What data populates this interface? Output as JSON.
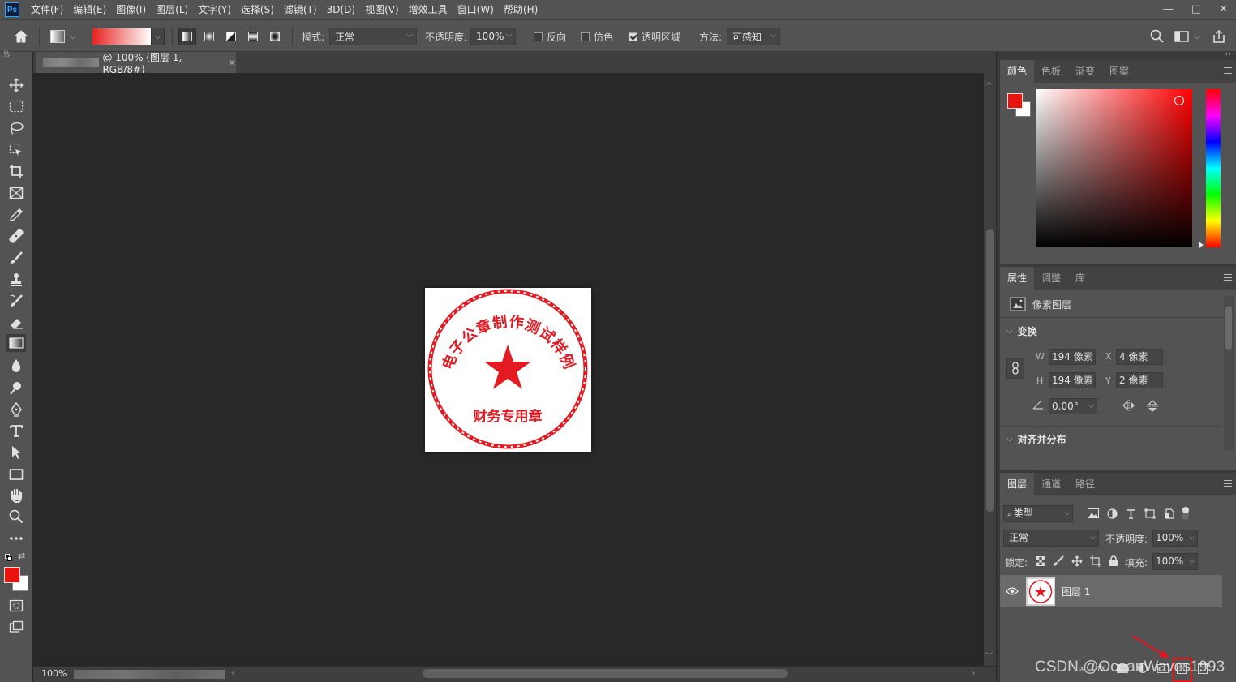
{
  "app": {
    "logo": "Ps"
  },
  "menubar": {
    "items": [
      "文件(F)",
      "编辑(E)",
      "图像(I)",
      "图层(L)",
      "文字(Y)",
      "选择(S)",
      "滤镜(T)",
      "3D(D)",
      "视图(V)",
      "增效工具",
      "窗口(W)",
      "帮助(H)"
    ],
    "window_buttons": [
      "—",
      "□",
      "✕"
    ]
  },
  "options": {
    "mode_label": "模式:",
    "mode_value": "正常",
    "opacity_label": "不透明度:",
    "opacity_value": "100%",
    "reverse_label": "反向",
    "reverse_checked": false,
    "dither_label": "仿色",
    "dither_checked": false,
    "transparency_label": "透明区域",
    "transparency_checked": true,
    "method_label": "方法:",
    "method_value": "可感知",
    "gradient_colors": [
      "#e8231f",
      "#ffffff"
    ]
  },
  "document": {
    "tab_title": "@ 100% (图层 1, RGB/8#)",
    "close": "×",
    "zoom": "100%"
  },
  "stamp": {
    "arc_text": "电子公章制作测试样例",
    "bottom_text": "财务专用章",
    "color": "#e21b23"
  },
  "colors": {
    "foreground": "#e8140f",
    "background": "#ffffff",
    "accent": "#31a8ff"
  },
  "color_panel": {
    "tabs": [
      "颜色",
      "色板",
      "渐变",
      "图案"
    ],
    "active_tab": "颜色",
    "foreground": "#e8140f",
    "background": "#ffffff"
  },
  "properties_panel": {
    "tabs": [
      "属性",
      "调整",
      "库"
    ],
    "active_tab": "属性",
    "layer_type": "像素图层",
    "transform_header": "变换",
    "w_label": "W",
    "w_value": "194 像素",
    "x_label": "X",
    "x_value": "4 像素",
    "h_label": "H",
    "h_value": "194 像素",
    "y_label": "Y",
    "y_value": "2 像素",
    "angle_value": "0.00°",
    "align_header": "对齐并分布"
  },
  "layers_panel": {
    "tabs": [
      "图层",
      "通道",
      "路径"
    ],
    "active_tab": "图层",
    "filter_label": "类型",
    "blend_mode": "正常",
    "opacity_label": "不透明度:",
    "opacity_value": "100%",
    "lock_label": "锁定:",
    "fill_label": "填充:",
    "fill_value": "100%",
    "layers": [
      {
        "name": "图层 1",
        "visible": true
      }
    ]
  },
  "watermark": "CSDN @OceanWaves1993"
}
